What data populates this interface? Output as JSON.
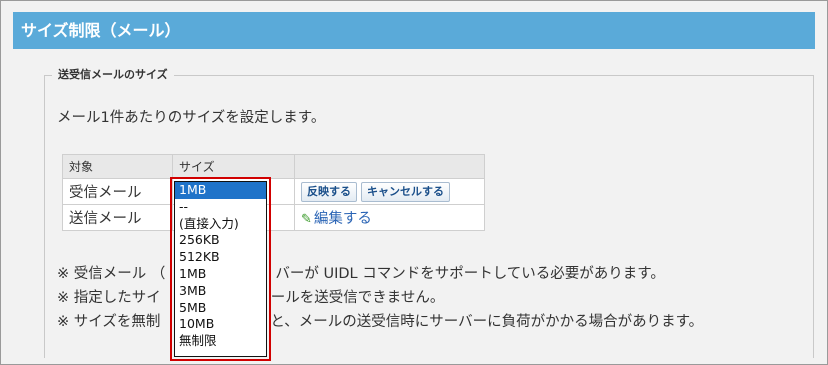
{
  "header": {
    "title": "サイズ制限（メール）"
  },
  "section": {
    "legend": "送受信メールのサイズ"
  },
  "description": "メール1件あたりのサイズを設定します。",
  "table": {
    "headers": [
      "対象",
      "サイズ",
      ""
    ],
    "rows": [
      {
        "target": "受信メール"
      },
      {
        "target": "送信メール"
      }
    ]
  },
  "actions": {
    "apply_label": "反映する",
    "cancel_label": "キャンセルする",
    "edit_label": "編集する"
  },
  "notes": [
    "※ 受信メール （",
    "バーが UIDL コマンドをサポートしている必要があります。",
    "※ 指定したサイ",
    "ールを送受信できません。",
    "※ サイズを無制",
    "と、メールの送受信時にサーバーに負荷がかかる場合があります。"
  ],
  "dropdown": {
    "selected": "1MB",
    "options": [
      "1MB",
      "--",
      "(直接入力)",
      "256KB",
      "512KB",
      "1MB",
      "3MB",
      "5MB",
      "10MB",
      "無制限"
    ]
  },
  "colors": {
    "header_bg": "#5aaad9",
    "selected_bg": "#1f73c9",
    "highlight": "#d10000"
  }
}
